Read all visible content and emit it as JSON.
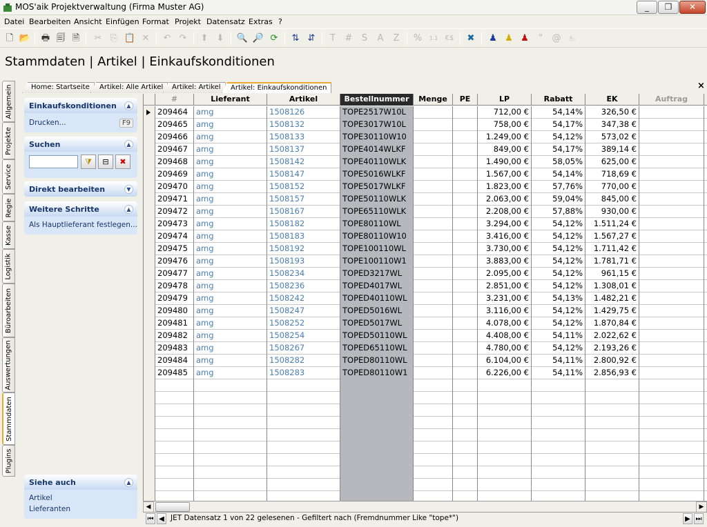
{
  "window": {
    "title": "MOS'aik Projektverwaltung (Firma Muster AG)"
  },
  "menu": [
    "Datei",
    "Bearbeiten",
    "Ansicht",
    "Einfügen",
    "Format",
    "Projekt",
    "Datensatz",
    "Extras",
    "?"
  ],
  "toolbar": {
    "icons": [
      "new-document-icon",
      "open-folder-icon",
      "print-icon",
      "print-preview-icon",
      "page-setup-icon",
      "cut-icon",
      "copy-icon",
      "paste-icon",
      "delete-icon",
      "undo-icon",
      "redo-icon",
      "move-up-icon",
      "move-down-icon",
      "search-icon",
      "find-replace-icon",
      "refresh-icon",
      "sort-ascending-icon",
      "sort-descending-icon"
    ],
    "format_buttons": [
      "T",
      "#",
      "S",
      "A",
      "Z",
      "%"
    ],
    "percent_label": "%",
    "currency_label": "€$",
    "quote_label": "\"",
    "at_label": "@"
  },
  "page": {
    "title": "Stammdaten | Artikel | Einkaufskonditionen"
  },
  "vtabs": [
    "Allgemein",
    "Projekte",
    "Service",
    "Regie",
    "Kasse",
    "Logistik",
    "Büroarbeiten",
    "Auswertungen",
    "Stammdaten",
    "Plugins"
  ],
  "active_vtab": "Stammdaten",
  "doc_tabs": [
    "Home: Startseite",
    "Artikel: Alle Artikel",
    "Artikel: Artikel",
    "Artikel: Einkaufskonditionen"
  ],
  "doc_close": "×",
  "taskpane": {
    "einkauf": {
      "title": "Einkaufskonditionen",
      "link": "Drucken...",
      "key": "F9"
    },
    "suchen": {
      "title": "Suchen",
      "value": ""
    },
    "direkt": {
      "title": "Direkt bearbeiten"
    },
    "weitere": {
      "title": "Weitere Schritte",
      "link": "Als Hauptlieferant festlegen..."
    },
    "siehe": {
      "title": "Siehe auch",
      "links": [
        "Artikel",
        "Lieferanten"
      ]
    }
  },
  "grid": {
    "columns": [
      "#",
      "Lieferant",
      "Artikel",
      "Bestellnummer",
      "Menge",
      "PE",
      "LP",
      "Rabatt",
      "EK",
      "Auftrag"
    ],
    "rows": [
      [
        "209464",
        "amg",
        "1508126",
        "TOPE2517W10L",
        "",
        "",
        "712,00 €",
        "54,14%",
        "326,50 €"
      ],
      [
        "209465",
        "amg",
        "1508132",
        "TOPE3017W10L",
        "",
        "",
        "758,00 €",
        "54,17%",
        "347,38 €"
      ],
      [
        "209466",
        "amg",
        "1508133",
        "TOPE30110W10",
        "",
        "",
        "1.249,00 €",
        "54,12%",
        "573,02 €"
      ],
      [
        "209467",
        "amg",
        "1508137",
        "TOPE4014WLKF",
        "",
        "",
        "849,00 €",
        "54,17%",
        "389,14 €"
      ],
      [
        "209468",
        "amg",
        "1508142",
        "TOPE40110WLK",
        "",
        "",
        "1.490,00 €",
        "58,05%",
        "625,00 €"
      ],
      [
        "209469",
        "amg",
        "1508147",
        "TOPE5016WLKF",
        "",
        "",
        "1.567,00 €",
        "54,14%",
        "718,69 €"
      ],
      [
        "209470",
        "amg",
        "1508152",
        "TOPE5017WLKF",
        "",
        "",
        "1.823,00 €",
        "57,76%",
        "770,00 €"
      ],
      [
        "209471",
        "amg",
        "1508157",
        "TOPE50110WLK",
        "",
        "",
        "2.063,00 €",
        "59,04%",
        "845,00 €"
      ],
      [
        "209472",
        "amg",
        "1508167",
        "TOPE65110WLK",
        "",
        "",
        "2.208,00 €",
        "57,88%",
        "930,00 €"
      ],
      [
        "209473",
        "amg",
        "1508182",
        "TOPE80110WL",
        "",
        "",
        "3.294,00 €",
        "54,12%",
        "1.511,24 €"
      ],
      [
        "209474",
        "amg",
        "1508183",
        "TOPE80110W10",
        "",
        "",
        "3.416,00 €",
        "54,12%",
        "1.567,27 €"
      ],
      [
        "209475",
        "amg",
        "1508192",
        "TOPE100110WL",
        "",
        "",
        "3.730,00 €",
        "54,12%",
        "1.711,42 €"
      ],
      [
        "209476",
        "amg",
        "1508193",
        "TOPE100110W1",
        "",
        "",
        "3.883,00 €",
        "54,12%",
        "1.781,71 €"
      ],
      [
        "209477",
        "amg",
        "1508234",
        "TOPED3217WL",
        "",
        "",
        "2.095,00 €",
        "54,12%",
        "961,15 €"
      ],
      [
        "209478",
        "amg",
        "1508236",
        "TOPED4017WL",
        "",
        "",
        "2.851,00 €",
        "54,12%",
        "1.308,01 €"
      ],
      [
        "209479",
        "amg",
        "1508242",
        "TOPED40110WL",
        "",
        "",
        "3.231,00 €",
        "54,13%",
        "1.482,21 €"
      ],
      [
        "209480",
        "amg",
        "1508247",
        "TOPED5016WL",
        "",
        "",
        "3.116,00 €",
        "54,12%",
        "1.429,75 €"
      ],
      [
        "209481",
        "amg",
        "1508252",
        "TOPED5017WL",
        "",
        "",
        "4.078,00 €",
        "54,12%",
        "1.870,84 €"
      ],
      [
        "209482",
        "amg",
        "1508254",
        "TOPED50110WL",
        "",
        "",
        "4.408,00 €",
        "54,11%",
        "2.022,62 €"
      ],
      [
        "209483",
        "amg",
        "1508267",
        "TOPED65110WL",
        "",
        "",
        "4.780,00 €",
        "54,12%",
        "2.193,26 €"
      ],
      [
        "209484",
        "amg",
        "1508282",
        "TOPED80110WL",
        "",
        "",
        "6.104,00 €",
        "54,11%",
        "2.800,92 €"
      ],
      [
        "209485",
        "amg",
        "1508283",
        "TOPED80110W1",
        "",
        "",
        "6.226,00 €",
        "54,11%",
        "2.856,93 €"
      ]
    ]
  },
  "status": {
    "text": "JET Datensatz 1 von 22 gelesenen - Gefiltert nach (Fremdnummer Like \"tope*\")"
  },
  "colors": {
    "accent": "#f0a830",
    "link": "#4b7fb4",
    "pane_blue": "#d8e6f8",
    "selected_column": "#b7b7be"
  }
}
